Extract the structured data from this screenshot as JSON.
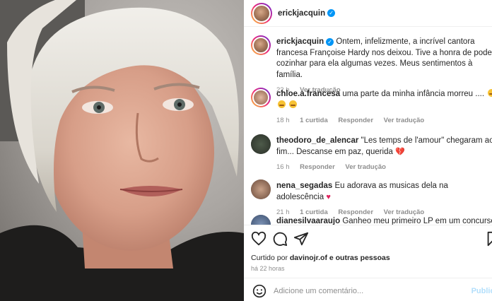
{
  "header": {
    "username": "erickjacquin",
    "verified_mark": "✓"
  },
  "caption": {
    "username": "erickjacquin",
    "text": "Ontem, infelizmente, a incrível cantora francesa Françoise Hardy nos deixou. Tive a honra de poder cozinhar para ela algumas vezes. Meus sentimentos à família.",
    "time": "22 h",
    "translate": "Ver tradução"
  },
  "comments": [
    {
      "username": "chloe.a.francesa",
      "text": "uma parte da minha infância morreu ....",
      "time": "18 h",
      "likes": "1 curtida",
      "reply": "Responder",
      "translate": "Ver tradução"
    },
    {
      "username": "theodoro_de_alencar",
      "text": "\"Les temps de l'amour\" chegaram ao fim... Descanse em paz, querida",
      "time": "16 h",
      "reply": "Responder",
      "translate": "Ver tradução"
    },
    {
      "username": "nena_segadas",
      "text": "Eu adorava as musicas dela na adolescência",
      "time": "21 h",
      "likes": "1 curtida",
      "reply": "Responder",
      "translate": "Ver tradução"
    },
    {
      "username": "dianesilvaaraujo",
      "text": "Ganheo meu primeiro LP em um concurso da"
    }
  ],
  "actions": {
    "icons": [
      "heart-icon",
      "comment-icon",
      "share-icon",
      "save-icon"
    ],
    "liked_by_prefix": "Curtido por",
    "liked_by_user": "davinojr.of",
    "liked_by_suffix": "e outras pessoas",
    "time": "há 22 horas"
  },
  "add_comment": {
    "placeholder": "Adicione um comentário...",
    "post_label": "Publicar"
  },
  "colors": {
    "accent": "#0095f6",
    "text": "#262626",
    "muted": "#8e8e8e",
    "heart": "#e0245e"
  }
}
